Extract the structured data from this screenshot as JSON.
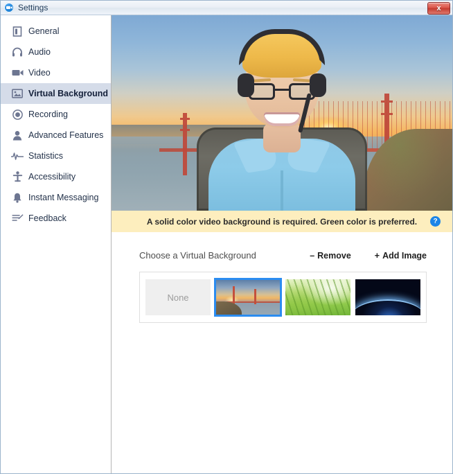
{
  "window": {
    "title": "Settings",
    "app_icon": "zoom-video-icon",
    "close_label": "x"
  },
  "sidebar": {
    "items": [
      {
        "label": "General",
        "icon": "document-icon",
        "active": false
      },
      {
        "label": "Audio",
        "icon": "headphones-icon",
        "active": false
      },
      {
        "label": "Video",
        "icon": "video-camera-icon",
        "active": false
      },
      {
        "label": "Virtual Background",
        "icon": "image-icon",
        "active": true
      },
      {
        "label": "Recording",
        "icon": "record-circle-icon",
        "active": false
      },
      {
        "label": "Advanced Features",
        "icon": "person-icon",
        "active": false
      },
      {
        "label": "Statistics",
        "icon": "waveform-icon",
        "active": false
      },
      {
        "label": "Accessibility",
        "icon": "accessibility-icon",
        "active": false
      },
      {
        "label": "Instant Messaging",
        "icon": "bell-icon",
        "active": false
      },
      {
        "label": "Feedback",
        "icon": "feedback-pencil-icon",
        "active": false
      }
    ]
  },
  "video_preview": {
    "description": "Live camera preview: person wearing headset and light blue polo shirt in front of Golden Gate Bridge sunset virtual background"
  },
  "notice": {
    "text": "A solid color video background is required. Green color is preferred.",
    "help_glyph": "?",
    "background_color": "#fdeebe"
  },
  "main": {
    "chooser_title": "Choose a Virtual Background",
    "remove_sign": "–",
    "remove_label": "Remove",
    "add_sign": "+",
    "add_label": "Add Image",
    "backgrounds": [
      {
        "name": "None",
        "label": "None",
        "selected": false
      },
      {
        "name": "golden-gate-bridge",
        "label": "",
        "selected": true
      },
      {
        "name": "grass",
        "label": "",
        "selected": false
      },
      {
        "name": "earth-from-space",
        "label": "",
        "selected": false
      }
    ]
  },
  "colors": {
    "accent": "#2b8cf0",
    "sidebar_active": "#d5dce9",
    "notice": "#fdeebe",
    "close_button": "#c3392e"
  }
}
